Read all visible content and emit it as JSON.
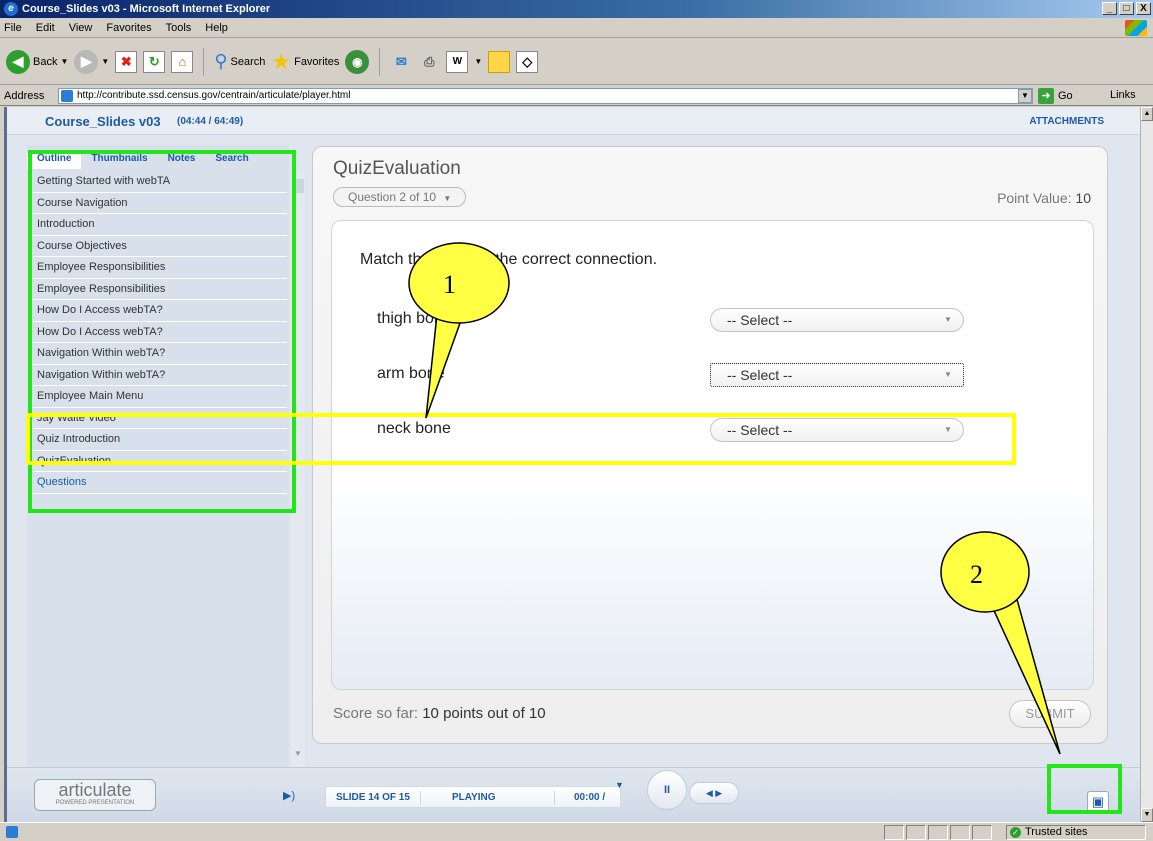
{
  "window": {
    "title": "Course_Slides v03 - Microsoft Internet Explorer",
    "controls": [
      "_",
      "□",
      "X"
    ]
  },
  "menubar": {
    "items": [
      "File",
      "Edit",
      "View",
      "Favorites",
      "Tools",
      "Help"
    ]
  },
  "toolbar": {
    "back_label": "Back",
    "search_label": "Search",
    "favorites_label": "Favorites"
  },
  "address": {
    "label": "Address",
    "url": "http://contribute.ssd.census.gov/centrain/articulate/player.html",
    "go_label": "Go",
    "links_label": "Links"
  },
  "player": {
    "course_title": "Course_Slides v03",
    "course_time": "(04:44 / 64:49)",
    "attachments_label": "ATTACHMENTS",
    "tabs": [
      "Outline",
      "Thumbnails",
      "Notes",
      "Search"
    ],
    "outline": [
      "Getting Started with webTA",
      "Course Navigation",
      "Introduction",
      "Course Objectives",
      "Employee Responsibilities",
      "Employee Responsibilities",
      "How Do I Access webTA?",
      "How Do I Access webTA?",
      "Navigation Within webTA?",
      "Navigation Within webTA?",
      "Employee Main Menu",
      "Jay Waite Video",
      "Quiz Introduction",
      "QuizEvaluation",
      "Questions"
    ],
    "quiz": {
      "title": "QuizEvaluation",
      "question_pill": "Question 2 of 10",
      "point_value_label": "Point Value:",
      "point_value": "10",
      "prompt": "Match the items to the correct connection.",
      "rows": [
        {
          "label": "thigh bone",
          "select": "-- Select --"
        },
        {
          "label": "arm bone",
          "select": "-- Select --"
        },
        {
          "label": "neck bone",
          "select": "-- Select --"
        }
      ],
      "score_label": "Score so far:",
      "score_value": "10 points out of 10",
      "submit_label": "SUBMIT"
    },
    "bottom": {
      "logo_main": "articulate",
      "logo_sub": "POWERED PRESENTATION",
      "slide_counter": "SLIDE 14 OF 15",
      "status": "PLAYING",
      "elapsed": "00:00 /",
      "pause_glyph": "II",
      "skip_glyph": "◀ ▶"
    }
  },
  "statusbar": {
    "zone": "Trusted sites"
  },
  "annotations": {
    "callout_1": "1",
    "callout_2": "2"
  },
  "colors": {
    "highlight_green": "#22e61a",
    "highlight_yellow": "#ffff00",
    "accent_blue": "#1e5aa8"
  }
}
